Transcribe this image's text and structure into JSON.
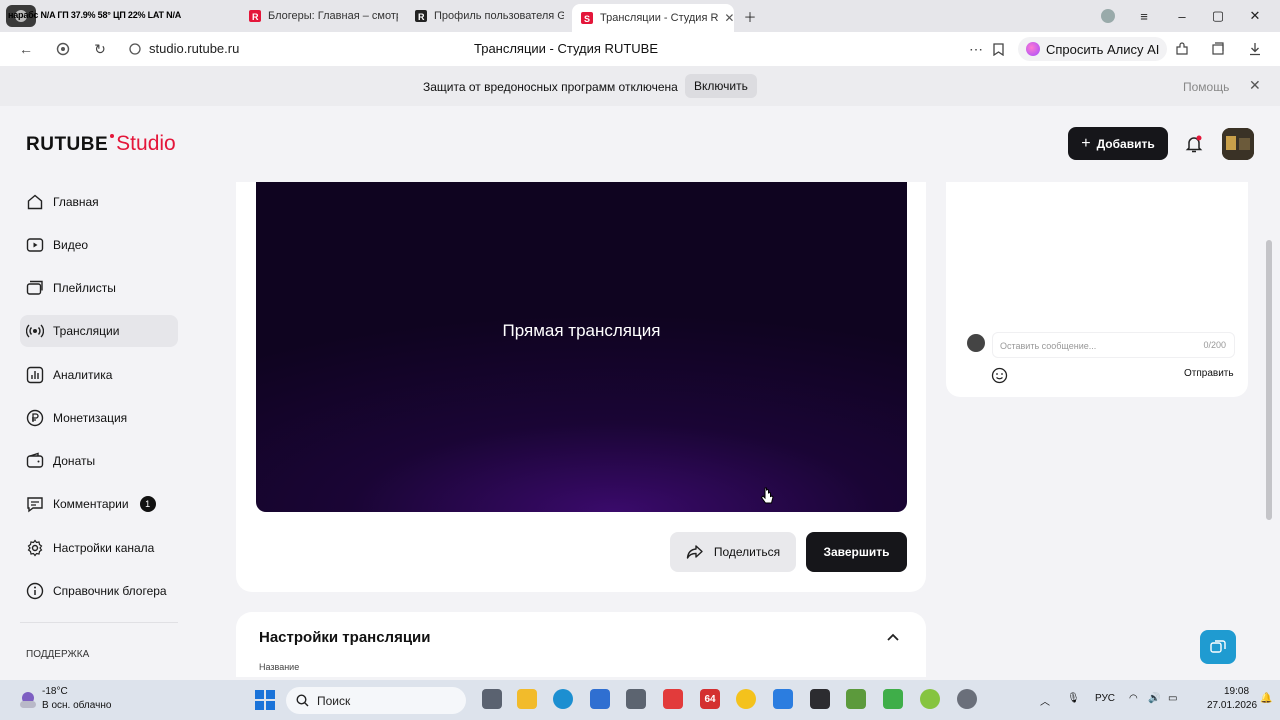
{
  "browser": {
    "ticker": "нарабс N/A   ГП 37.9% 58° ЦП 22%   LAT N/A",
    "tabs": [
      {
        "label": "Блогеры: Главная – смотр"
      },
      {
        "label": "Профиль пользователя G"
      },
      {
        "label": "Трансляции - Студия R",
        "active": true
      }
    ],
    "url": "studio.rutube.ru",
    "page_title": "Трансляции - Студия RUTUBE",
    "alice_label": "Спросить Алису AI"
  },
  "warning": {
    "text": "Защита от вредоносных программ отключена",
    "enable_label": "Включить",
    "help_label": "Помощь"
  },
  "header": {
    "logo_rutube": "RUTUBE",
    "logo_studio": "Studio",
    "add_label": "Добавить"
  },
  "sidebar": {
    "items": [
      {
        "label": "Главная",
        "icon": "home-icon"
      },
      {
        "label": "Видео",
        "icon": "video-icon"
      },
      {
        "label": "Плейлисты",
        "icon": "playlist-icon"
      },
      {
        "label": "Трансляции",
        "icon": "broadcast-icon",
        "active": true
      },
      {
        "label": "Аналитика",
        "icon": "analytics-icon"
      },
      {
        "label": "Монетизация",
        "icon": "ruble-icon"
      },
      {
        "label": "Донаты",
        "icon": "wallet-icon"
      },
      {
        "label": "Комментарии",
        "icon": "comment-icon",
        "badge": "1"
      },
      {
        "label": "Настройки канала",
        "icon": "gear-icon"
      },
      {
        "label": "Справочник блогера",
        "icon": "info-icon"
      }
    ],
    "support_label": "ПОДДЕРЖКА"
  },
  "player": {
    "title": "Прямая трансляция"
  },
  "actions": {
    "share_label": "Поделиться",
    "finish_label": "Завершить"
  },
  "settings": {
    "title": "Настройки трансляции",
    "name_label": "Название"
  },
  "chat": {
    "placeholder": "Оставить сообщение...",
    "counter": "0/200",
    "send_label": "Отправить"
  },
  "taskbar": {
    "temperature": "-18°C",
    "weather": "В осн. облачно",
    "search_label": "Поиск",
    "lang": "РУС",
    "time": "19:08",
    "date": "27.01.2026",
    "badge_64": "64"
  },
  "colors": {
    "accent": "#e4163a",
    "dark_button": "#16161a",
    "player_purple": "#3a0a6b",
    "float_blue": "#1f9bd1"
  }
}
